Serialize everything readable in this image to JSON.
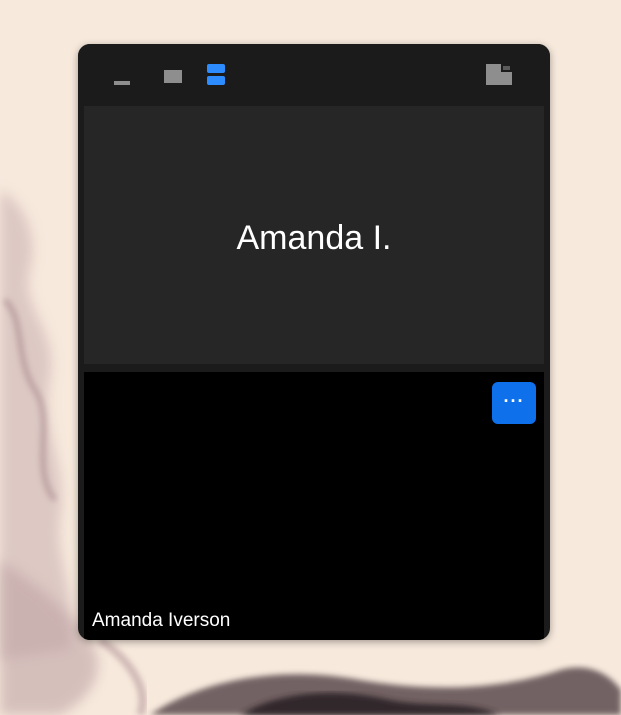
{
  "window": {
    "toolbar": {
      "buttons": [
        {
          "name": "minimize",
          "icon": "minimize-icon",
          "selected": false
        },
        {
          "name": "speaker-view",
          "icon": "speaker-view-icon",
          "selected": false
        },
        {
          "name": "thumbnail-view",
          "icon": "thumbnail-view-icon",
          "selected": true
        },
        {
          "name": "exit-mini-window",
          "icon": "exit-mini-window-icon",
          "selected": false
        }
      ],
      "accent_color": "#2d8cff"
    },
    "active_speaker": {
      "display_name": "Amanda I."
    },
    "self_view": {
      "participant_name": "Amanda Iverson",
      "more_button_label": "···",
      "more_button_color": "#0e71eb"
    }
  }
}
